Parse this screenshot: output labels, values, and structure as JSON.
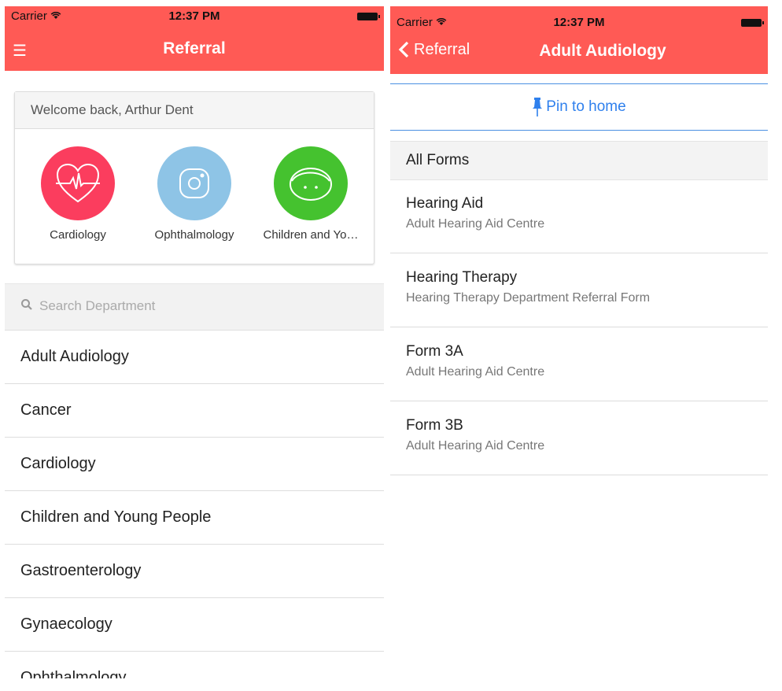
{
  "status_bar": {
    "carrier": "Carrier",
    "time": "12:37 PM"
  },
  "left": {
    "nav_title": "Referral",
    "menu_icon": "☰",
    "welcome": "Welcome back, Arthur Dent",
    "favorites": [
      {
        "label": "Cardiology",
        "color": "#fb3d5e",
        "icon": "heart-pulse-icon"
      },
      {
        "label": "Ophthalmology",
        "color": "#8ec4e6",
        "icon": "camera-lens-icon"
      },
      {
        "label": "Children and Yo…",
        "color": "#45c22f",
        "icon": "child-face-icon"
      }
    ],
    "search_placeholder": "Search Department",
    "departments": [
      "Adult Audiology",
      "Cancer",
      "Cardiology",
      "Children and Young People",
      "Gastroenterology",
      "Gynaecology",
      "Ophthalmology"
    ]
  },
  "right": {
    "back_label": "Referral",
    "nav_title": "Adult Audiology",
    "pin_label": "Pin to home",
    "section_title": "All Forms",
    "forms": [
      {
        "title": "Hearing Aid",
        "subtitle": "Adult Hearing Aid Centre"
      },
      {
        "title": "Hearing Therapy",
        "subtitle": "Hearing Therapy Department Referral Form"
      },
      {
        "title": "Form 3A",
        "subtitle": "Adult Hearing Aid Centre"
      },
      {
        "title": "Form 3B",
        "subtitle": "Adult Hearing Aid Centre"
      }
    ]
  },
  "colors": {
    "accent": "#ff5a55",
    "link": "#2f80ed"
  }
}
